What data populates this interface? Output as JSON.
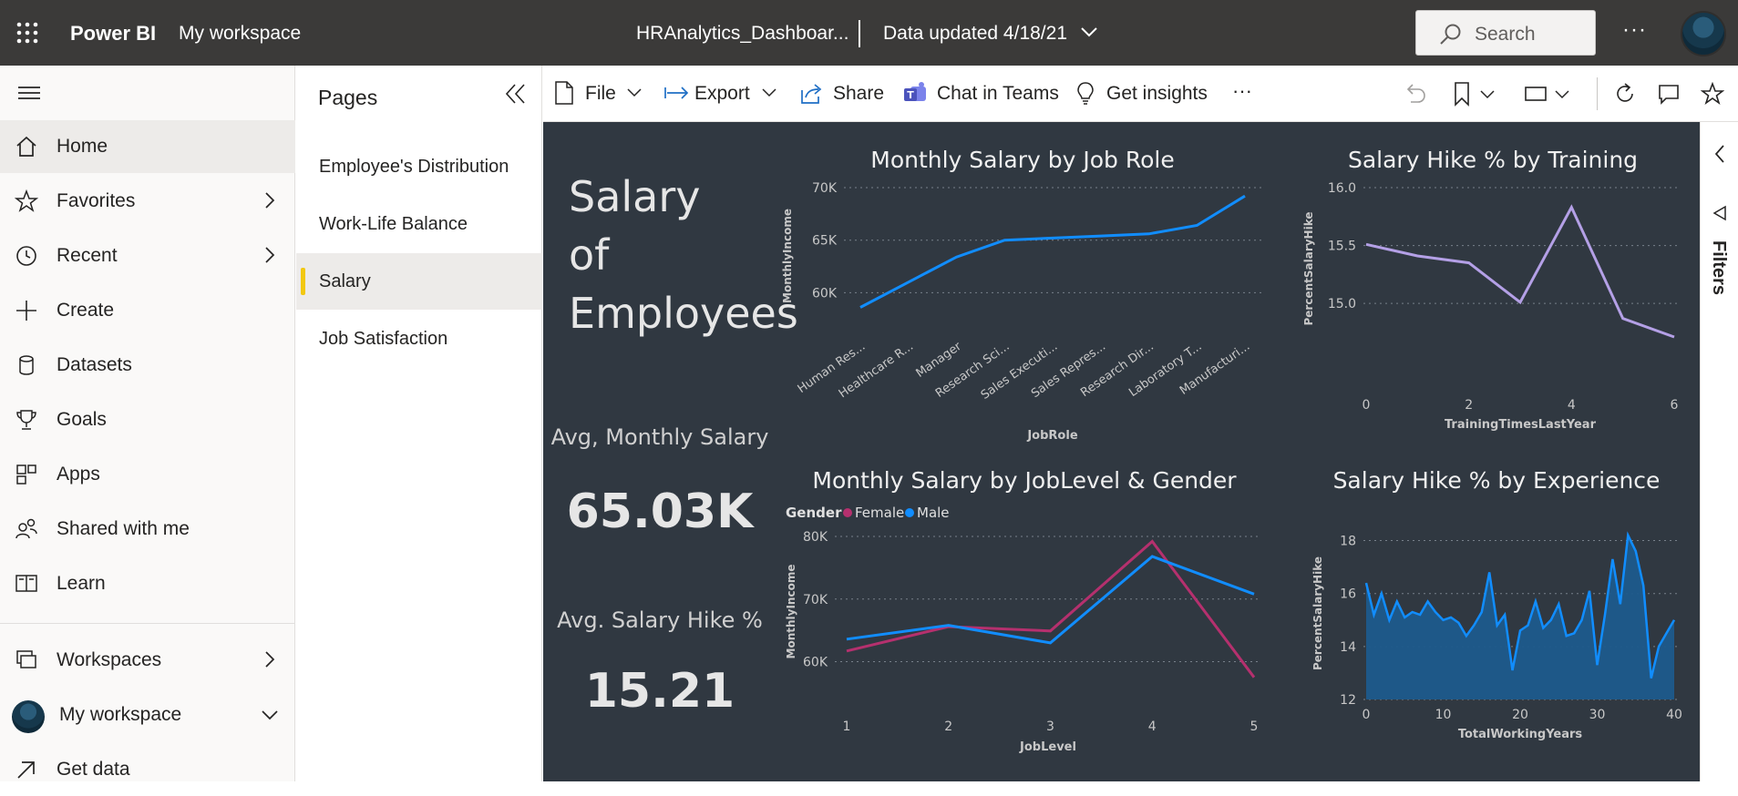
{
  "topbar": {
    "brand": "Power BI",
    "workspace": "My workspace",
    "report_title": "HRAnalytics_Dashboar...",
    "data_updated": "Data updated 4/18/21",
    "search_placeholder": "Search",
    "more": "···"
  },
  "nav": {
    "items": [
      {
        "label": "Home",
        "icon": "home-icon"
      },
      {
        "label": "Favorites",
        "icon": "star-icon"
      },
      {
        "label": "Recent",
        "icon": "clock-icon"
      },
      {
        "label": "Create",
        "icon": "plus-icon"
      },
      {
        "label": "Datasets",
        "icon": "database-icon"
      },
      {
        "label": "Goals",
        "icon": "trophy-icon"
      },
      {
        "label": "Apps",
        "icon": "apps-icon"
      },
      {
        "label": "Shared with me",
        "icon": "shared-icon"
      },
      {
        "label": "Learn",
        "icon": "book-icon"
      },
      {
        "label": "Workspaces",
        "icon": "workspaces-icon"
      },
      {
        "label": "My workspace",
        "icon": "avatar"
      },
      {
        "label": "Get data",
        "icon": "arrow-up-right-icon"
      }
    ]
  },
  "pages": {
    "title": "Pages",
    "items": [
      "Employee's Distribution",
      "Work-Life Balance",
      "Salary",
      "Job Satisfaction"
    ],
    "active": "Salary"
  },
  "toolbar": {
    "file": "File",
    "export": "Export",
    "share": "Share",
    "chat": "Chat in Teams",
    "insights": "Get insights",
    "more": "···"
  },
  "filters": {
    "label": "Filters"
  },
  "dashboard": {
    "heading_lines": [
      "Salary",
      "of",
      "Employees"
    ],
    "kpi1_label": "Avg, Monthly Salary",
    "kpi1_value": "65.03K",
    "kpi2_label": "Avg. Salary Hike %",
    "kpi2_value": "15.21"
  },
  "colors": {
    "canvas_bg": "#303841",
    "blue": "#118dff",
    "purple_line": "#b4a0e6",
    "female": "#b5306e",
    "area_fill": "#1d5a8c"
  },
  "chart_data": [
    {
      "type": "line",
      "title": "Monthly Salary by Job Role",
      "xlabel": "JobRole",
      "ylabel": "MonthlyIncome",
      "categories": [
        "Human Res...",
        "Healthcare R...",
        "Manager",
        "Research Sci...",
        "Sales Executi...",
        "Sales Repres...",
        "Research Dir...",
        "Laboratory T...",
        "Manufacturi..."
      ],
      "values": [
        58600,
        61000,
        63400,
        65000,
        65200,
        65400,
        65600,
        66400,
        69200
      ],
      "yticks": [
        "60K",
        "65K",
        "70K"
      ],
      "ylim": [
        57000,
        70000
      ],
      "grid": true
    },
    {
      "type": "line",
      "title": "Salary Hike % by Training",
      "xlabel": "TrainingTimesLastYear",
      "ylabel": "PercentSalaryHike",
      "x": [
        0,
        1,
        2,
        3,
        4,
        5,
        6
      ],
      "values": [
        15.51,
        15.41,
        15.35,
        15.01,
        15.83,
        14.87,
        14.71
      ],
      "xticks": [
        "0",
        "2",
        "4",
        "6"
      ],
      "yticks": [
        "15.0",
        "15.5",
        "16.0"
      ],
      "ylim": [
        14.6,
        16.0
      ],
      "grid": true
    },
    {
      "type": "line",
      "title": "Monthly Salary by JobLevel & Gender",
      "xlabel": "JobLevel",
      "ylabel": "MonthlyIncome",
      "legend_title": "Gender",
      "x": [
        1,
        2,
        3,
        4,
        5
      ],
      "series": [
        {
          "name": "Female",
          "values": [
            61700,
            65600,
            64900,
            79200,
            57500
          ]
        },
        {
          "name": "Male",
          "values": [
            63600,
            65800,
            63000,
            76800,
            70800
          ]
        }
      ],
      "yticks": [
        "60K",
        "70K",
        "80K"
      ],
      "ylim": [
        56000,
        80000
      ],
      "grid": true
    },
    {
      "type": "area",
      "title": "Salary Hike % by Experience",
      "xlabel": "TotalWorkingYears",
      "ylabel": "PercentSalaryHike",
      "x": [
        0,
        1,
        2,
        3,
        4,
        5,
        6,
        7,
        8,
        9,
        10,
        11,
        12,
        13,
        14,
        15,
        16,
        17,
        18,
        19,
        20,
        21,
        22,
        23,
        24,
        25,
        26,
        27,
        28,
        29,
        30,
        31,
        32,
        33,
        34,
        35,
        36,
        37,
        38,
        39,
        40
      ],
      "values": [
        16.4,
        15.2,
        16.0,
        15.0,
        15.7,
        15.1,
        15.3,
        15.2,
        15.7,
        15.3,
        15.0,
        15.1,
        14.9,
        14.4,
        14.8,
        15.3,
        16.8,
        14.8,
        15.2,
        13.1,
        14.6,
        14.8,
        15.7,
        14.7,
        15.0,
        15.6,
        14.4,
        14.5,
        15.0,
        16.1,
        13.3,
        15.2,
        17.3,
        15.6,
        18.2,
        17.6,
        16.3,
        12.8,
        14.0,
        14.5,
        15.0
      ],
      "xticks": [
        "0",
        "10",
        "20",
        "30",
        "40"
      ],
      "yticks": [
        "12",
        "14",
        "16",
        "18"
      ],
      "ylim": [
        12,
        18.5
      ],
      "grid": true
    }
  ]
}
